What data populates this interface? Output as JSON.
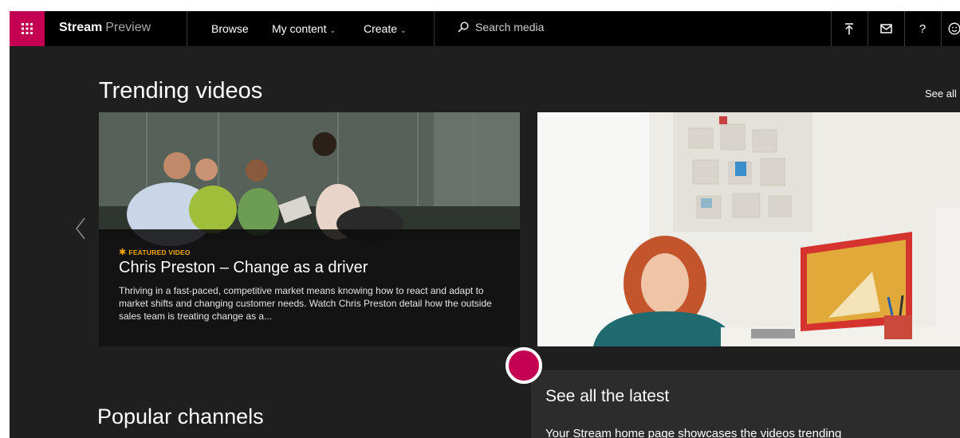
{
  "topbar": {
    "brand_name": "Stream",
    "brand_suffix": "Preview",
    "nav": [
      {
        "label": "Browse"
      },
      {
        "label": "My content"
      },
      {
        "label": "Create"
      }
    ],
    "search_placeholder": "Search media",
    "icons": [
      "app-launcher-icon",
      "upload-icon",
      "message-icon",
      "help-icon",
      "account-icon"
    ],
    "help_label": "?",
    "accent_color": "#c30052"
  },
  "trending": {
    "title": "Trending videos",
    "see_all": "See all",
    "featured": {
      "badge": "FEATURED VIDEO",
      "title": "Chris Preston – Change as a driver",
      "description": "Thriving in a fast-paced, competitive market means knowing how to react and adapt to market shifts and changing customer needs. Watch Chris Preston detail how the outside sales team is treating change as a..."
    }
  },
  "popular": {
    "title": "Popular channels"
  },
  "callout": {
    "title": "See all the latest",
    "text": "Your Stream home page showcases the videos trending"
  }
}
